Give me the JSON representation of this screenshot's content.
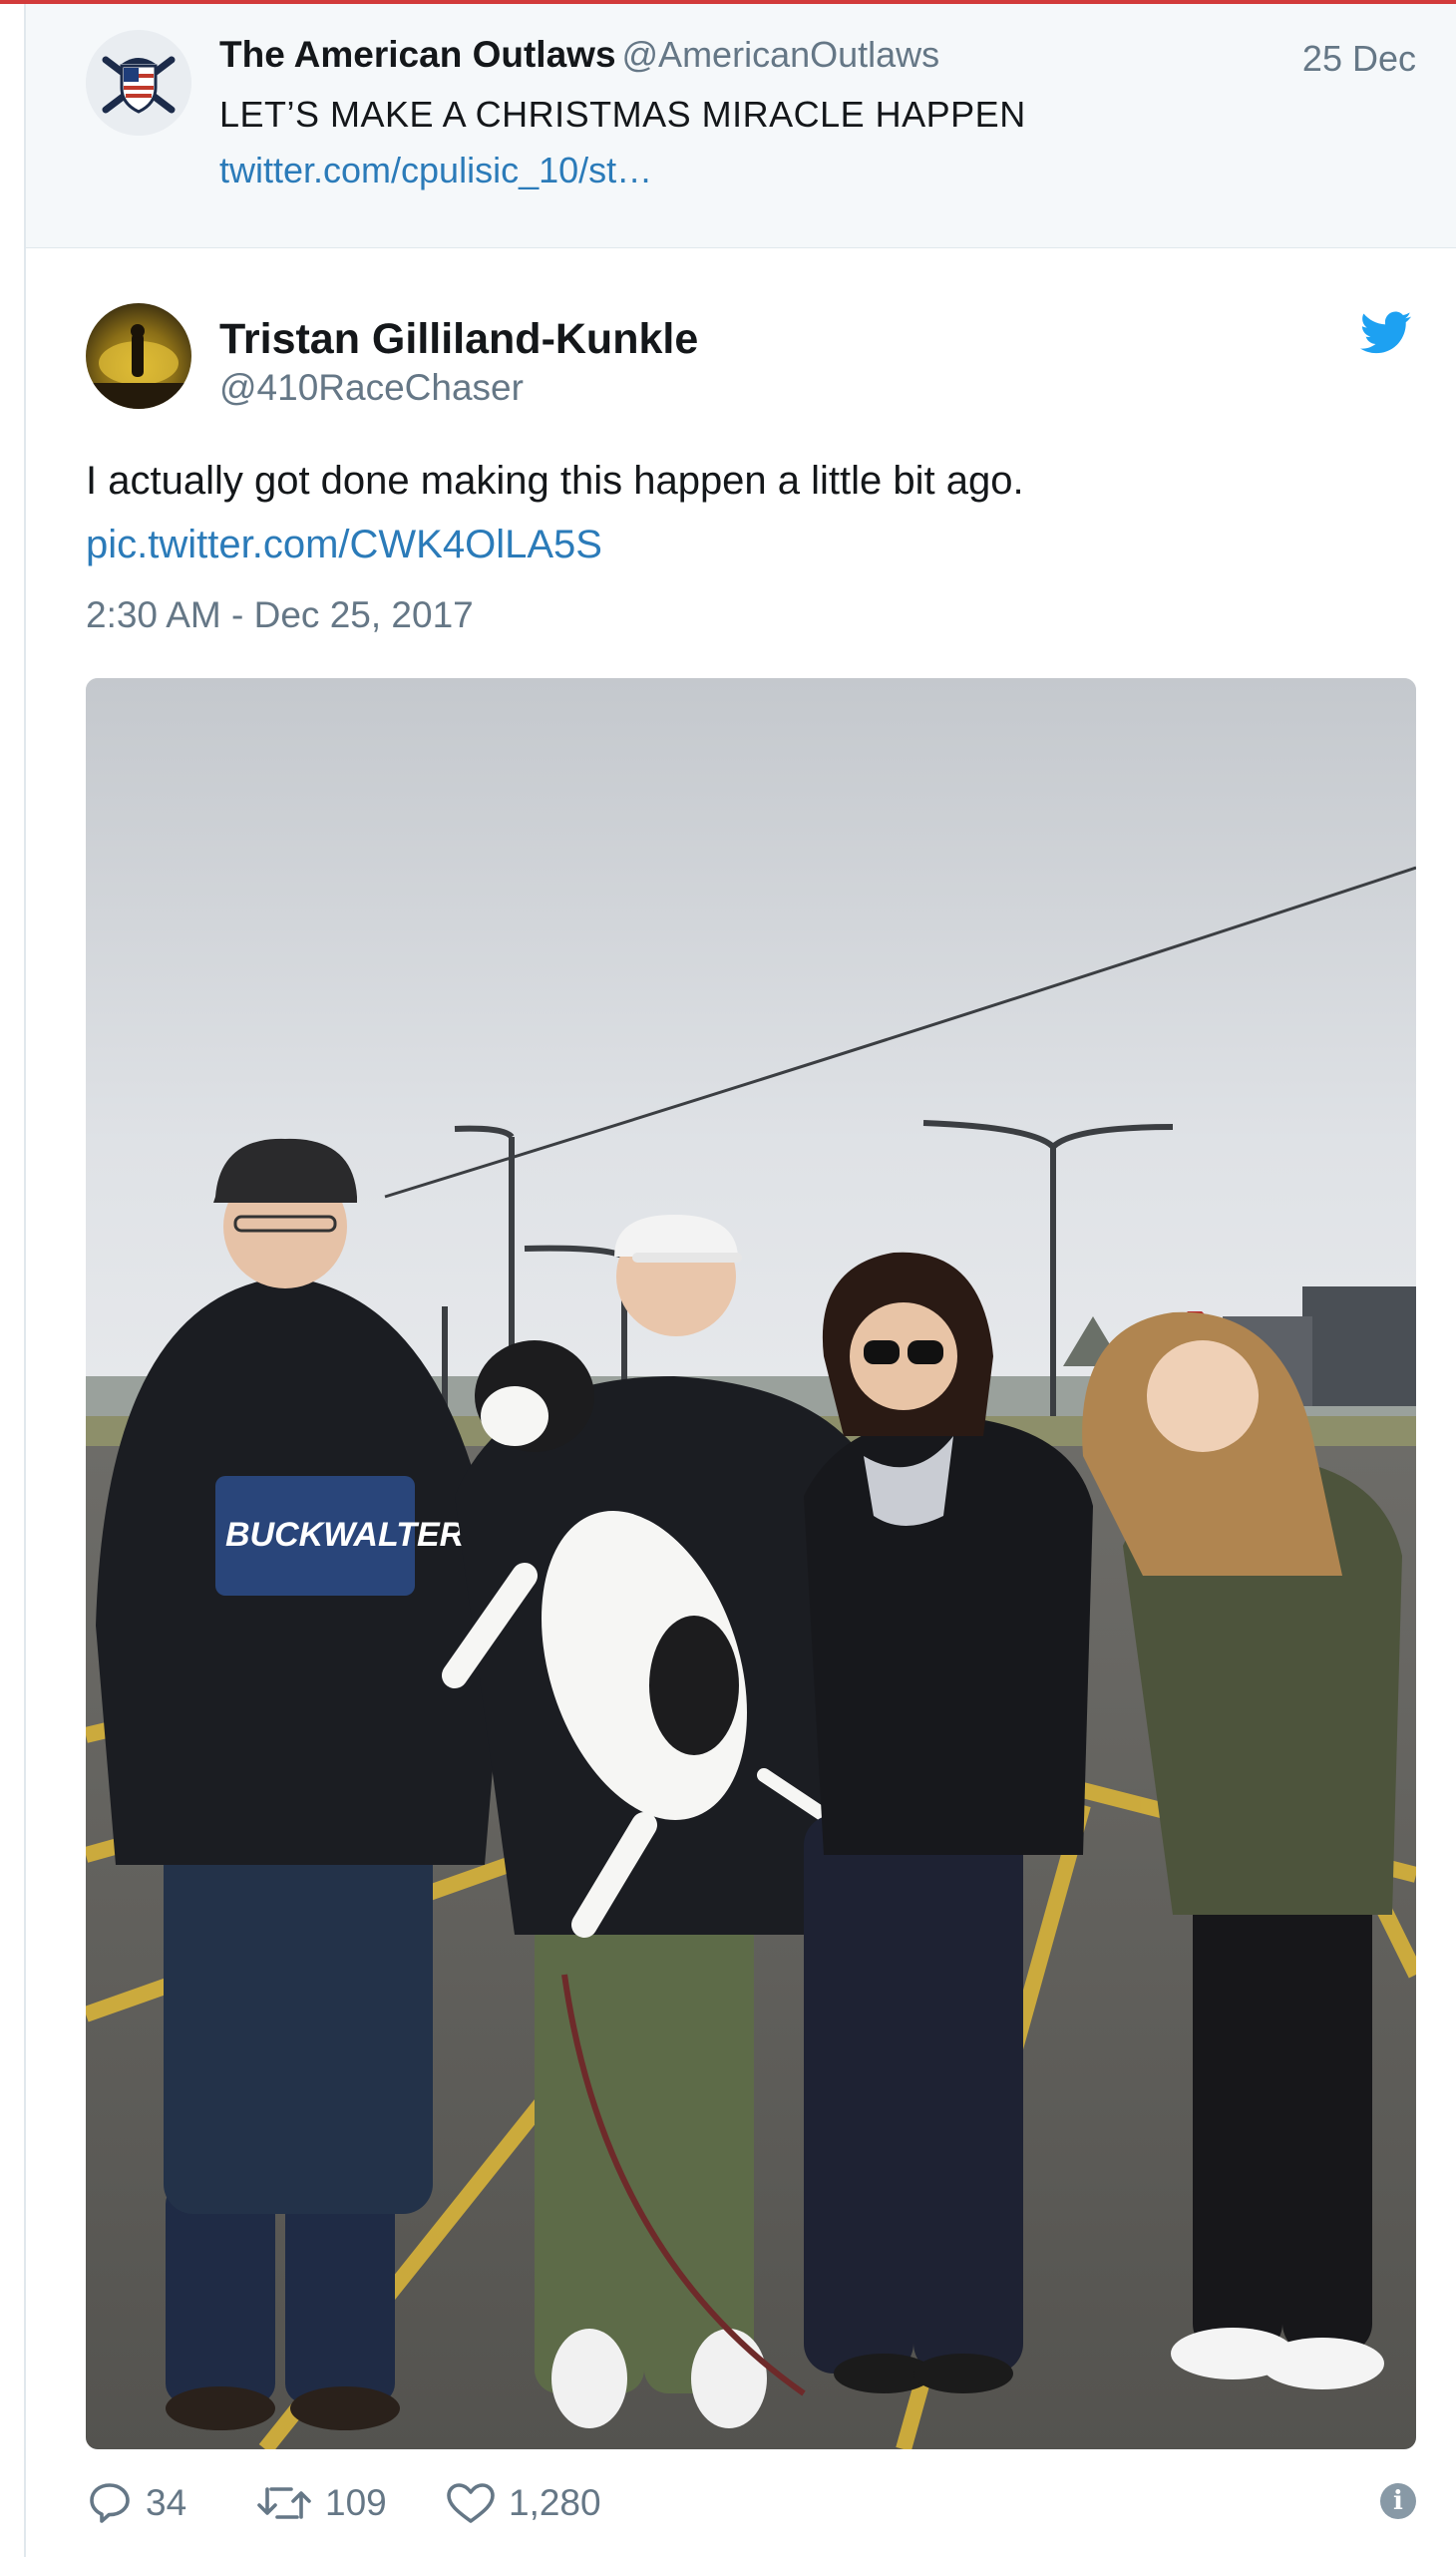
{
  "parent_tweet": {
    "name": "The American Outlaws",
    "handle": "@AmericanOutlaws",
    "date": "25 Dec",
    "text": "LET’S MAKE A CHRISTMAS MIRACLE HAPPEN",
    "link": "twitter.com/cpulisic_10/st…"
  },
  "tweet": {
    "name": "Tristan Gilliland-Kunkle",
    "handle": "@410RaceChaser",
    "text": "I actually got done making this happen a little bit ago.",
    "pic_link": "pic.twitter.com/CWK4OlLA5S",
    "timestamp": "2:30 AM - Dec 25, 2017",
    "photo": {
      "hoodie_print": "BUCKWALTER"
    }
  },
  "actions": {
    "replies": "34",
    "retweets": "109",
    "likes": "1,280"
  },
  "colors": {
    "link": "#2b7bb9",
    "secondary_text": "#657786",
    "twitter_blue": "#1da1f2",
    "top_rule": "#d23b3b"
  },
  "icons": [
    "reply-icon",
    "retweet-icon",
    "heart-icon",
    "info-icon",
    "twitter-bird-icon"
  ]
}
